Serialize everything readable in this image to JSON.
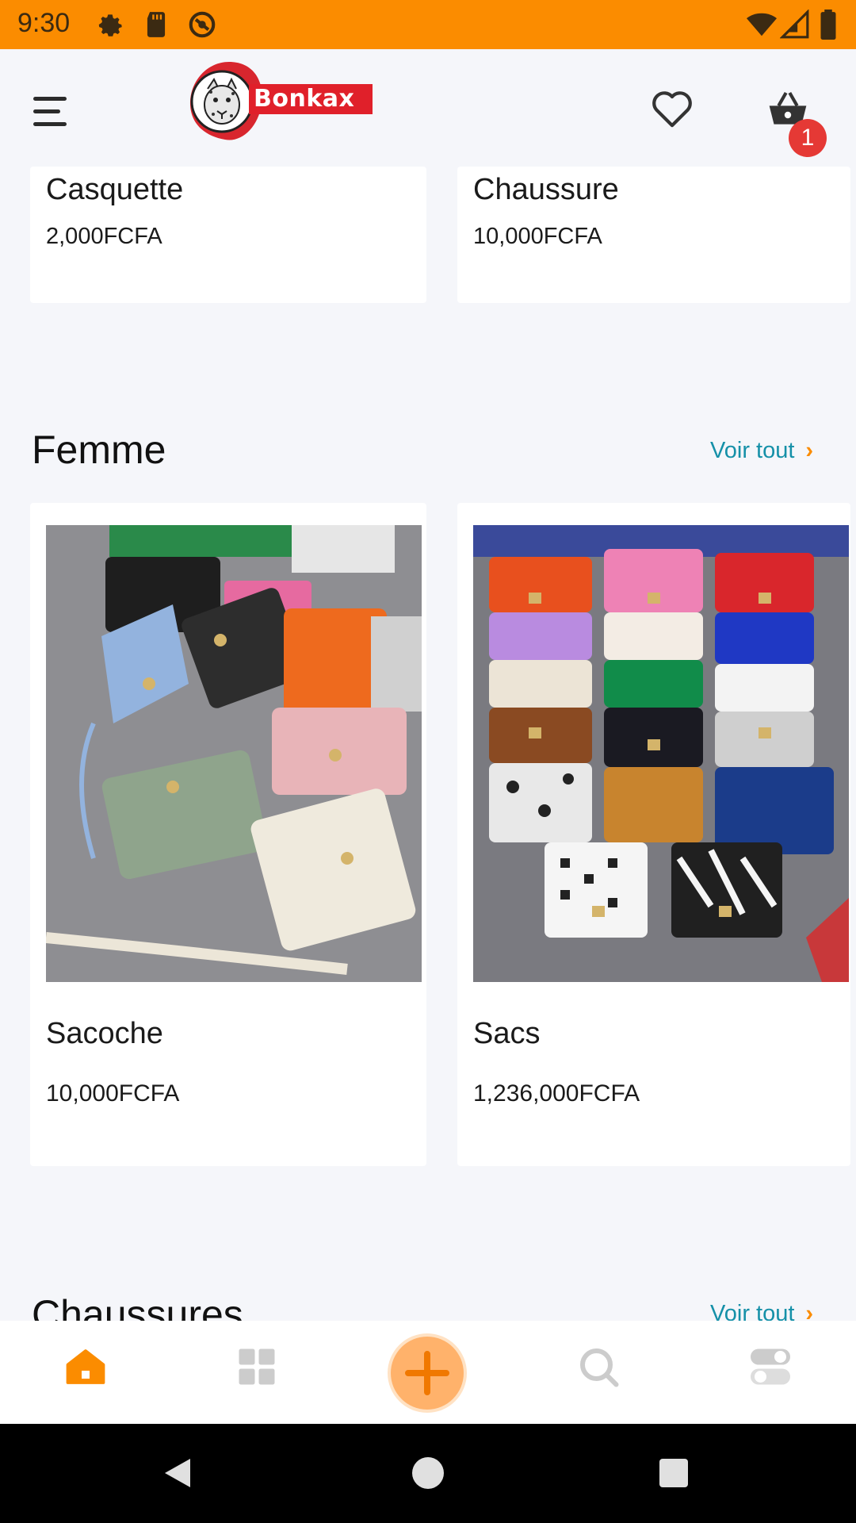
{
  "status_bar": {
    "time": "9:30"
  },
  "header": {
    "logo_text": "Bonkax",
    "cart_count": "1"
  },
  "top_row": [
    {
      "name": "Casquette",
      "price": "2,000FCFA"
    },
    {
      "name": "Chaussure",
      "price": "10,000FCFA"
    }
  ],
  "sections": [
    {
      "title": "Femme",
      "see_all": "Voir tout",
      "products": [
        {
          "name": "Sacoche",
          "price": "10,000FCFA"
        },
        {
          "name": "Sacs",
          "price": "1,236,000FCFA"
        }
      ]
    },
    {
      "title": "Chaussures",
      "see_all": "Voir tout"
    }
  ],
  "bottom_nav": {
    "items": [
      "home-icon",
      "grid-icon",
      "add-icon",
      "search-icon",
      "toggle-icon"
    ],
    "active": "home-icon"
  },
  "colors": {
    "accent": "#fb8c00",
    "link": "#1590a8",
    "badge": "#e53935"
  }
}
